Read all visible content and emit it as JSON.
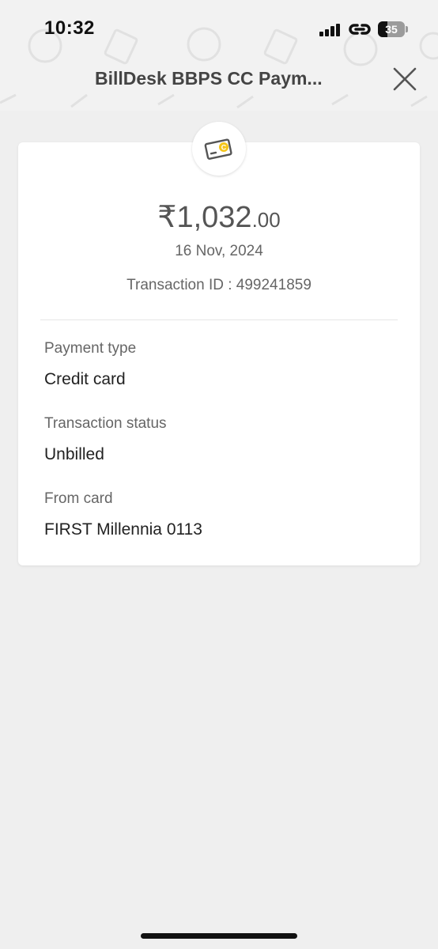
{
  "status_bar": {
    "time": "10:32",
    "battery": "35"
  },
  "header": {
    "title": "BillDesk BBPS CC Paym...",
    "close_icon": "close-icon"
  },
  "transaction": {
    "amount_main": "₹1,032",
    "amount_decimal": ".00",
    "date": "16 Nov, 2024",
    "transaction_id": "Transaction ID : 499241859",
    "fields": [
      {
        "label": "Payment type",
        "value": "Credit card"
      },
      {
        "label": "Transaction status",
        "value": "Unbilled"
      },
      {
        "label": "From card",
        "value": "FIRST Millennia 0113"
      }
    ]
  },
  "colors": {
    "background": "#efefef",
    "card": "#ffffff",
    "accent_yellow": "#f5c518",
    "text_primary": "#222222",
    "text_secondary": "#666666"
  }
}
